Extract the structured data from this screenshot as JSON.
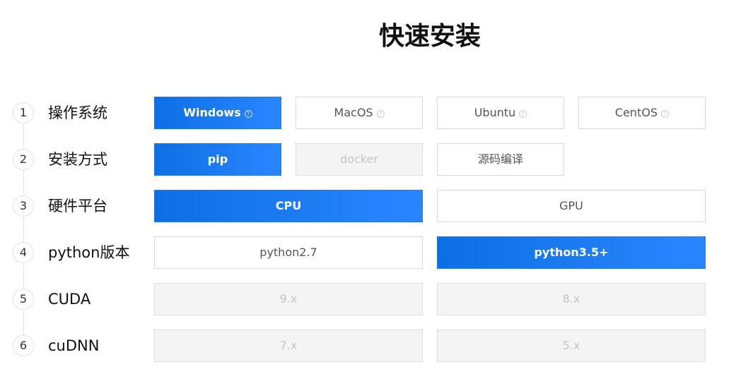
{
  "page_title": "快速安装",
  "colors": {
    "accent_start": "#0d6fe3",
    "accent_end": "#2a86ff",
    "disabled_bg": "#f4f4f4"
  },
  "steps": [
    {
      "number": "1",
      "label": "操作系统",
      "options": [
        {
          "label": "Windows",
          "state": "active",
          "help_icon": "question-icon"
        },
        {
          "label": "MacOS",
          "state": "normal",
          "help_icon": "question-icon"
        },
        {
          "label": "Ubuntu",
          "state": "normal",
          "help_icon": "question-icon"
        },
        {
          "label": "CentOS",
          "state": "normal",
          "help_icon": "question-icon"
        }
      ]
    },
    {
      "number": "2",
      "label": "安装方式",
      "options": [
        {
          "label": "pip",
          "state": "active"
        },
        {
          "label": "docker",
          "state": "disabled"
        },
        {
          "label": "源码编译",
          "state": "normal"
        }
      ]
    },
    {
      "number": "3",
      "label": "硬件平台",
      "options": [
        {
          "label": "CPU",
          "state": "active"
        },
        {
          "label": "GPU",
          "state": "normal"
        }
      ]
    },
    {
      "number": "4",
      "label": "python版本",
      "options": [
        {
          "label": "python2.7",
          "state": "normal"
        },
        {
          "label": "python3.5+",
          "state": "active"
        }
      ]
    },
    {
      "number": "5",
      "label": "CUDA",
      "options": [
        {
          "label": "9.x",
          "state": "disabled"
        },
        {
          "label": "8.x",
          "state": "disabled"
        }
      ]
    },
    {
      "number": "6",
      "label": "cuDNN",
      "options": [
        {
          "label": "7.x",
          "state": "disabled"
        },
        {
          "label": "5.x",
          "state": "disabled"
        }
      ]
    }
  ]
}
